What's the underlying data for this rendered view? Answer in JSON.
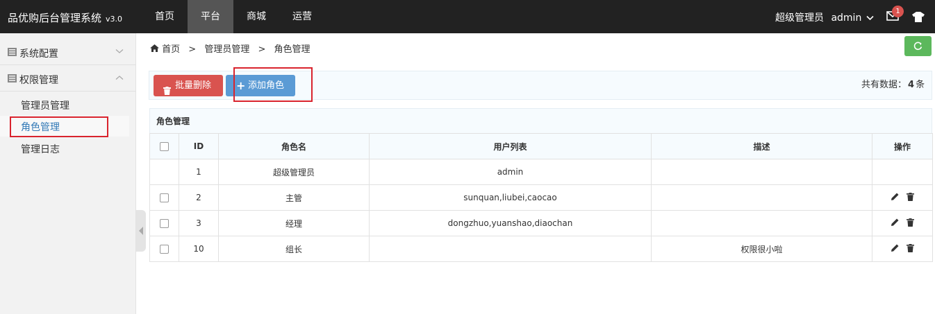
{
  "app": {
    "title": "品优购后台管理系统",
    "version": "v3.0"
  },
  "nav": {
    "items": [
      "首页",
      "平台",
      "商城",
      "运营"
    ],
    "active_index": 1
  },
  "user": {
    "role": "超级管理员",
    "name": "admin",
    "unread_messages": "1"
  },
  "sidebar": {
    "groups": [
      {
        "label": "系统配置",
        "expanded": false
      },
      {
        "label": "权限管理",
        "expanded": true
      }
    ],
    "sub_items": [
      "管理员管理",
      "角色管理",
      "管理日志"
    ],
    "active_sub": "角色管理"
  },
  "breadcrumb": {
    "home": "首页",
    "sep": ">",
    "items": [
      "管理员管理",
      "角色管理"
    ]
  },
  "toolbar": {
    "batch_delete_label": "批量删除",
    "add_role_label": "添加角色",
    "total_prefix": "共有数据：",
    "total_count": "4",
    "total_suffix": "条"
  },
  "table": {
    "caption": "角色管理",
    "headers": [
      "ID",
      "角色名",
      "用户列表",
      "描述",
      "操作"
    ],
    "rows": [
      {
        "id": "1",
        "name": "超级管理员",
        "users": "admin",
        "desc": "",
        "checkbox": false,
        "actions": false
      },
      {
        "id": "2",
        "name": "主管",
        "users": "sunquan,liubei,caocao",
        "desc": "",
        "checkbox": true,
        "actions": true
      },
      {
        "id": "3",
        "name": "经理",
        "users": "dongzhuo,yuanshao,diaochan",
        "desc": "",
        "checkbox": true,
        "actions": true
      },
      {
        "id": "10",
        "name": "组长",
        "users": "",
        "desc": "权限很小啦",
        "checkbox": true,
        "actions": true
      }
    ]
  },
  "colors": {
    "topbar": "#222222",
    "danger": "#d9534f",
    "primary": "#5b9bd5",
    "success": "#5cb85c",
    "highlight": "#d9232d"
  }
}
